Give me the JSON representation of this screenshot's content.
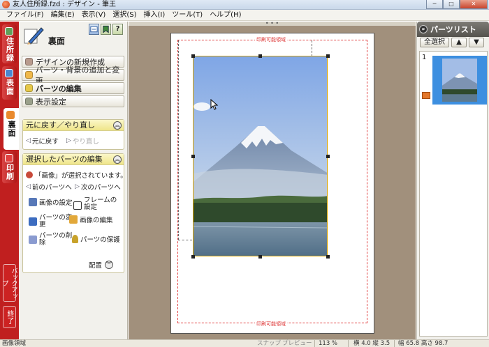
{
  "window": {
    "title": "友人住所録.fzd : デザイン - 筆王",
    "buttons": [
      "─",
      "□",
      "✕"
    ]
  },
  "menu": [
    "ファイル(F)",
    "編集(E)",
    "表示(V)",
    "選択(S)",
    "挿入(I)",
    "ツール(T)",
    "ヘルプ(H)"
  ],
  "left_tabs": {
    "address": "住所録",
    "front": "表面",
    "back": "裏面",
    "print": "印刷",
    "backup": "バックアップ",
    "exit": "終了"
  },
  "panel": {
    "title": "裏面",
    "head_buttons": [
      "?"
    ],
    "main_buttons": [
      {
        "label": "デザインの新規作成",
        "color": "#b89a8c"
      },
      {
        "label": "パーツ・背景の追加と変更",
        "color": "#f0b84a"
      },
      {
        "label": "パーツの編集",
        "color": "#e6c848"
      },
      {
        "label": "表示設定",
        "color": "#9aa08a"
      }
    ],
    "undo_box": {
      "title": "元に戻す／やり直し",
      "undo": "元に戻す",
      "redo": "やり直し"
    },
    "edit_box": {
      "title": "選択したパーツの編集",
      "selected_msg": "「画像」が選択されています。",
      "prev": "前のパーツへ",
      "next": "次のパーツへ",
      "image_settings": "画像の設定",
      "frame_settings": "フレームの設定",
      "change_part_1": "パーツの変",
      "change_part_2": "更",
      "edit_image": "画像の編集",
      "delete_part_1": "パーツの削",
      "delete_part_2": "除",
      "protect_part": "パーツの保護",
      "layout": "配置"
    }
  },
  "canvas": {
    "print_area_label": "印刷可能領域"
  },
  "parts_list": {
    "title": "パーツリスト",
    "select_all": "全選択",
    "items": [
      {
        "number": "1"
      }
    ]
  },
  "status": {
    "area": "画像領域",
    "snap": "スナップ",
    "preview": "プレビュー",
    "zoom": "113 %",
    "position": "横 4.0  縦 3.5",
    "size": "幅 65.8  高さ 98.7"
  },
  "colors": {
    "accent_red": "#c01f1f",
    "workspace": "#a1907c",
    "selection_blue": "#3d8fe0",
    "print_bound": "#e14040"
  },
  "icons": [
    "app-icon",
    "pen-icon",
    "bookmark-icon",
    "help-icon",
    "undo-icon",
    "redo-icon",
    "person-icon",
    "image-settings-icon",
    "frame-icon",
    "change-part-icon",
    "edit-image-icon",
    "delete-icon",
    "key-icon",
    "chevron-up-icon",
    "chevron-down-icon",
    "double-chevron-icon",
    "cursor-icon"
  ]
}
